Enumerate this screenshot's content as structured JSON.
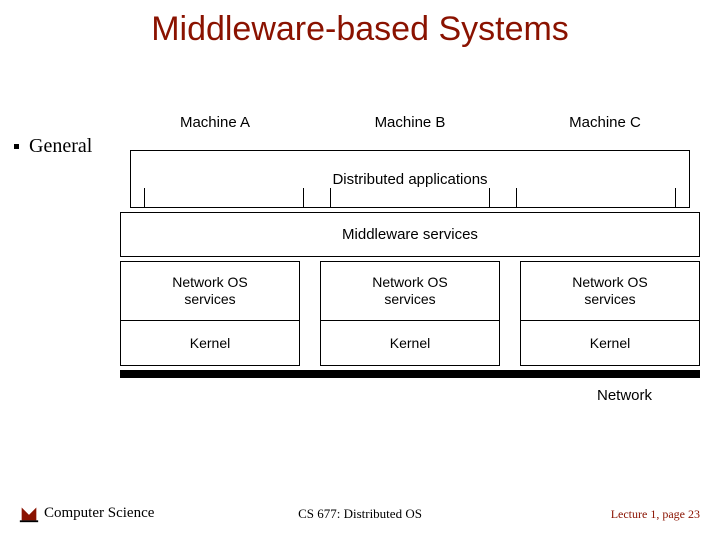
{
  "title": "Middleware-based Systems",
  "bullet": "General",
  "machines": {
    "a": "Machine A",
    "b": "Machine B",
    "c": "Machine C"
  },
  "layers": {
    "apps": "Distributed applications",
    "middleware": "Middleware services",
    "netos": "Network OS\nservices",
    "kernel": "Kernel",
    "network": "Network"
  },
  "footer": {
    "dept": "Computer Science",
    "course": "CS 677: Distributed OS",
    "page": "Lecture 1, page 23"
  }
}
